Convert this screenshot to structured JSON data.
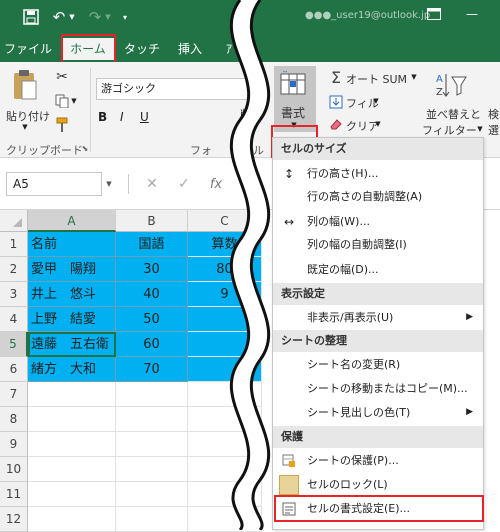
{
  "titlebar": {
    "account": "●●●_user19@outlook.jp",
    "restore_icon": "restore-window-icon"
  },
  "tabs": [
    {
      "label": "ファイル"
    },
    {
      "label": "ホーム"
    },
    {
      "label": "タッチ"
    },
    {
      "label": "挿入"
    }
  ],
  "ribbon": {
    "paste": "貼り付け",
    "clipboard_group": "クリップボード",
    "font_name": "游ゴシック",
    "font_group_partial": "フォ",
    "cell_group_partial": "セル",
    "delete": "削除",
    "format": "書式",
    "autosum": "オート SUM",
    "fill": "フィル",
    "clear": "クリア",
    "sort_filter_line1": "並べ替えと",
    "sort_filter_line2": "フィルター",
    "find_line1": "検",
    "find_line2": "選"
  },
  "formulabar": {
    "namebox": "A5"
  },
  "grid": {
    "columns": [
      "A",
      "B",
      "C"
    ],
    "rows": [
      {
        "num": "1",
        "a": "名前",
        "b": "国語",
        "c": "算数"
      },
      {
        "num": "2",
        "a": "愛甲　陽翔",
        "b": "30",
        "c": "80"
      },
      {
        "num": "3",
        "a": "井上　悠斗",
        "b": "40",
        "c": "9"
      },
      {
        "num": "4",
        "a": "上野　結愛",
        "b": "50",
        "c": ""
      },
      {
        "num": "5",
        "a": "遠藤　五右衛",
        "b": "60",
        "c": ""
      },
      {
        "num": "6",
        "a": "緒方　大和",
        "b": "70",
        "c": ""
      },
      {
        "num": "7",
        "a": "",
        "b": "",
        "c": ""
      },
      {
        "num": "8",
        "a": "",
        "b": "",
        "c": ""
      },
      {
        "num": "9",
        "a": "",
        "b": "",
        "c": ""
      },
      {
        "num": "10",
        "a": "",
        "b": "",
        "c": ""
      },
      {
        "num": "11",
        "a": "",
        "b": "",
        "c": ""
      },
      {
        "num": "12",
        "a": "",
        "b": "",
        "c": ""
      }
    ]
  },
  "menu": {
    "sections": [
      {
        "header": "セルのサイズ",
        "items": [
          {
            "label": "行の高さ(H)...",
            "icon": "row-height-icon"
          },
          {
            "label": "行の高さの自動調整(A)"
          },
          {
            "label": "列の幅(W)...",
            "icon": "column-width-icon"
          },
          {
            "label": "列の幅の自動調整(I)"
          },
          {
            "label": "既定の幅(D)..."
          }
        ]
      },
      {
        "header": "表示設定",
        "items": [
          {
            "label": "非表示/再表示(U)",
            "submenu": true
          }
        ]
      },
      {
        "header": "シートの整理",
        "items": [
          {
            "label": "シート名の変更(R)"
          },
          {
            "label": "シートの移動またはコピー(M)..."
          },
          {
            "label": "シート見出しの色(T)",
            "submenu": true
          }
        ]
      },
      {
        "header": "保護",
        "items": [
          {
            "label": "シートの保護(P)...",
            "icon": "protect-sheet-icon"
          },
          {
            "label": "セルのロック(L)",
            "icon": "lock-cell-icon"
          },
          {
            "label": "セルの書式設定(E)...",
            "icon": "format-cells-icon"
          }
        ]
      }
    ]
  },
  "colors": {
    "excel_green": "#217346",
    "highlight": "#00b0f0",
    "red_box": "#e8242b"
  }
}
